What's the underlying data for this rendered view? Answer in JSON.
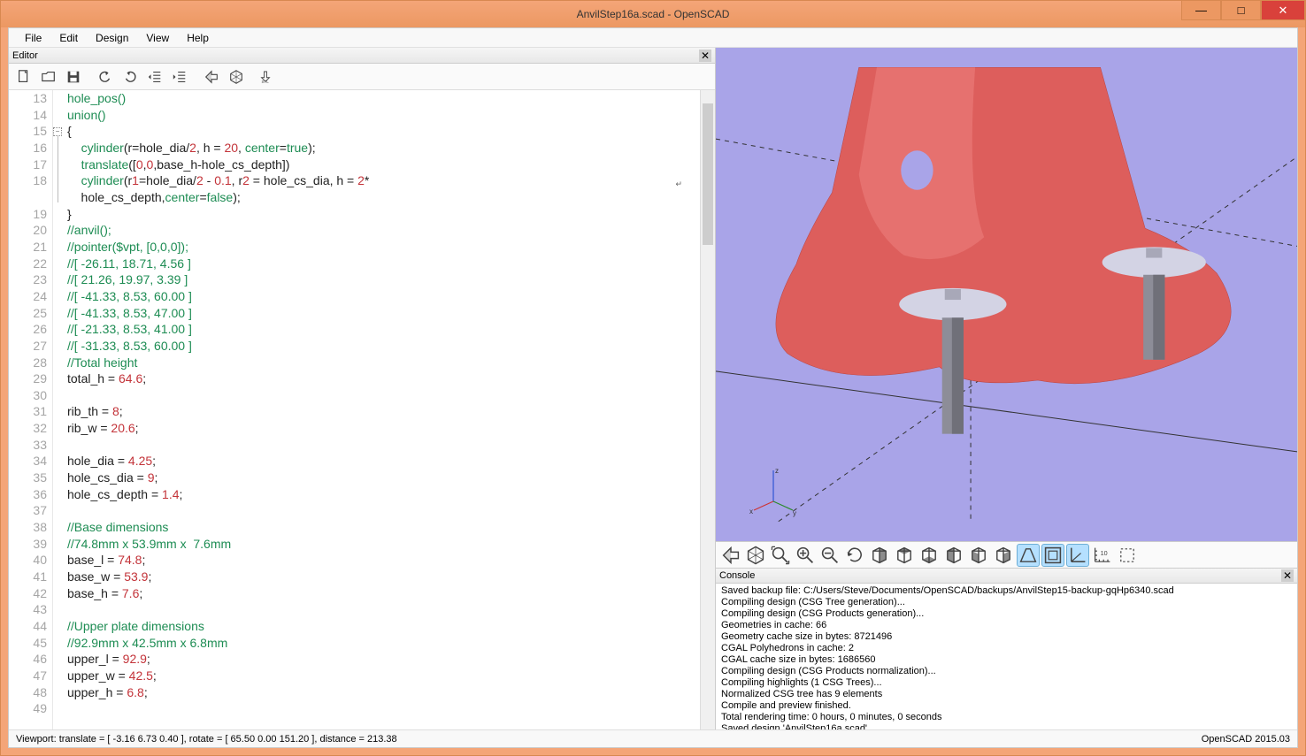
{
  "title": "AnvilStep16a.scad - OpenSCAD",
  "menu": [
    "File",
    "Edit",
    "Design",
    "View",
    "Help"
  ],
  "editor_label": "Editor",
  "console_label": "Console",
  "status_left": "Viewport: translate = [ -3.16 6.73 0.40 ], rotate = [ 65.50 0.00 151.20 ], distance = 213.38",
  "status_right": "OpenSCAD 2015.03",
  "code": [
    {
      "n": 13,
      "t": "hole_pos()",
      "cls": "kw"
    },
    {
      "n": 14,
      "t": "union()",
      "cls": "kw"
    },
    {
      "n": 15,
      "t": "{",
      "cls": "punct"
    },
    {
      "n": 16,
      "t": "    cylinder(r=hole_dia/2, h = 20, center=true);",
      "cls": "mix1"
    },
    {
      "n": 17,
      "t": "    translate([0,0,base_h-hole_cs_depth])",
      "cls": "mix2",
      "hl": true
    },
    {
      "n": 18,
      "t": "    cylinder(r1=hole_dia/2 - 0.1, r2 = hole_cs_dia, h = 2*",
      "cls": "mix3"
    },
    {
      "n": 0,
      "t": "    hole_cs_depth,center=false);",
      "cls": "mix4"
    },
    {
      "n": 19,
      "t": "}",
      "cls": "punct"
    },
    {
      "n": 20,
      "t": "//anvil();",
      "cls": "comment"
    },
    {
      "n": 21,
      "t": "//pointer($vpt, [0,0,0]);",
      "cls": "comment"
    },
    {
      "n": 22,
      "t": "//[ -26.11, 18.71, 4.56 ]",
      "cls": "comment"
    },
    {
      "n": 23,
      "t": "//[ 21.26, 19.97, 3.39 ]",
      "cls": "comment"
    },
    {
      "n": 24,
      "t": "//[ -41.33, 8.53, 60.00 ]",
      "cls": "comment"
    },
    {
      "n": 25,
      "t": "//[ -41.33, 8.53, 47.00 ]",
      "cls": "comment"
    },
    {
      "n": 26,
      "t": "//[ -21.33, 8.53, 41.00 ]",
      "cls": "comment"
    },
    {
      "n": 27,
      "t": "//[ -31.33, 8.53, 60.00 ]",
      "cls": "comment"
    },
    {
      "n": 28,
      "t": "//Total height",
      "cls": "comment"
    },
    {
      "n": 29,
      "t": "total_h = 64.6;",
      "cls": "assignN"
    },
    {
      "n": 30,
      "t": "",
      "cls": ""
    },
    {
      "n": 31,
      "t": "rib_th = 8;",
      "cls": "assignN"
    },
    {
      "n": 32,
      "t": "rib_w = 20.6;",
      "cls": "assignN"
    },
    {
      "n": 33,
      "t": "",
      "cls": ""
    },
    {
      "n": 34,
      "t": "hole_dia = 4.25;",
      "cls": "assignN"
    },
    {
      "n": 35,
      "t": "hole_cs_dia = 9;",
      "cls": "assignN"
    },
    {
      "n": 36,
      "t": "hole_cs_depth = 1.4;",
      "cls": "assignN"
    },
    {
      "n": 37,
      "t": "",
      "cls": ""
    },
    {
      "n": 38,
      "t": "//Base dimensions",
      "cls": "comment"
    },
    {
      "n": 39,
      "t": "//74.8mm x 53.9mm x  7.6mm",
      "cls": "comment"
    },
    {
      "n": 40,
      "t": "base_l = 74.8;",
      "cls": "assignN"
    },
    {
      "n": 41,
      "t": "base_w = 53.9;",
      "cls": "assignN"
    },
    {
      "n": 42,
      "t": "base_h = 7.6;",
      "cls": "assignN"
    },
    {
      "n": 43,
      "t": "",
      "cls": ""
    },
    {
      "n": 44,
      "t": "//Upper plate dimensions",
      "cls": "comment"
    },
    {
      "n": 45,
      "t": "//92.9mm x 42.5mm x 6.8mm",
      "cls": "comment"
    },
    {
      "n": 46,
      "t": "upper_l = 92.9;",
      "cls": "assignN"
    },
    {
      "n": 47,
      "t": "upper_w = 42.5;",
      "cls": "assignN"
    },
    {
      "n": 48,
      "t": "upper_h = 6.8;",
      "cls": "assignN"
    },
    {
      "n": 49,
      "t": "",
      "cls": ""
    }
  ],
  "console": [
    "Saved backup file: C:/Users/Steve/Documents/OpenSCAD/backups/AnvilStep15-backup-gqHp6340.scad",
    "Compiling design (CSG Tree generation)...",
    "Compiling design (CSG Products generation)...",
    "Geometries in cache: 66",
    "Geometry cache size in bytes: 8721496",
    "CGAL Polyhedrons in cache: 2",
    "CGAL cache size in bytes: 1686560",
    "Compiling design (CSG Products normalization)...",
    "Compiling highlights (1 CSG Trees)...",
    "Normalized CSG tree has 9 elements",
    "Compile and preview finished.",
    "Total rendering time: 0 hours, 0 minutes, 0 seconds",
    "Saved design 'AnvilStep16a.scad'."
  ],
  "editor_tools": [
    {
      "name": "new-icon"
    },
    {
      "name": "open-icon"
    },
    {
      "name": "save-icon"
    },
    {
      "sep": true
    },
    {
      "name": "undo-icon"
    },
    {
      "name": "redo-icon"
    },
    {
      "name": "unindent-icon"
    },
    {
      "name": "indent-icon"
    },
    {
      "sep": true
    },
    {
      "name": "preview-icon"
    },
    {
      "name": "render-icon"
    },
    {
      "sep": true
    },
    {
      "name": "export-stl-icon"
    }
  ],
  "viewport_tools": [
    {
      "name": "preview-vp-icon"
    },
    {
      "name": "render-vp-icon"
    },
    {
      "name": "zoom-all-icon"
    },
    {
      "name": "zoom-in-icon"
    },
    {
      "name": "zoom-out-icon"
    },
    {
      "name": "reset-view-icon"
    },
    {
      "name": "view-right-icon"
    },
    {
      "name": "view-top-icon"
    },
    {
      "name": "view-bottom-icon"
    },
    {
      "name": "view-left-icon"
    },
    {
      "name": "view-front-icon"
    },
    {
      "name": "view-back-icon"
    },
    {
      "name": "perspective-icon",
      "active": true
    },
    {
      "name": "orthogonal-icon",
      "active": true
    },
    {
      "name": "axes-icon",
      "active": true
    },
    {
      "name": "scale-markers-icon"
    },
    {
      "name": "show-edges-icon"
    }
  ]
}
